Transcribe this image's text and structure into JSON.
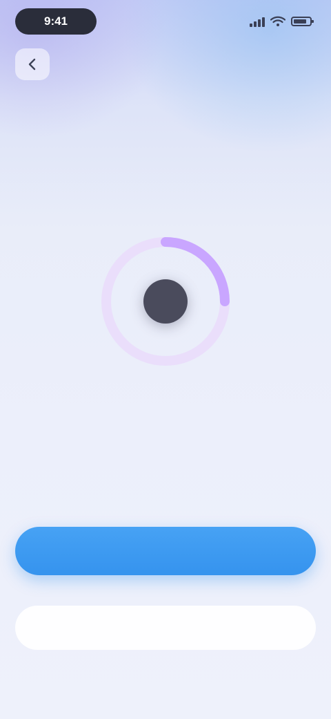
{
  "status_bar": {
    "time": "9:41"
  },
  "header": {
    "back_icon": "chevron-left-icon"
  },
  "content": {
    "title": "",
    "subtitle": ""
  },
  "recorder": {
    "progress": 0.25,
    "status_text": "",
    "colors": {
      "ring": "#c9a6ff",
      "button": "#4a4b5c"
    }
  },
  "actions": {
    "primary_label": "",
    "secondary_label": "",
    "footer_note": "",
    "colors": {
      "primary": "#3593ee"
    }
  }
}
